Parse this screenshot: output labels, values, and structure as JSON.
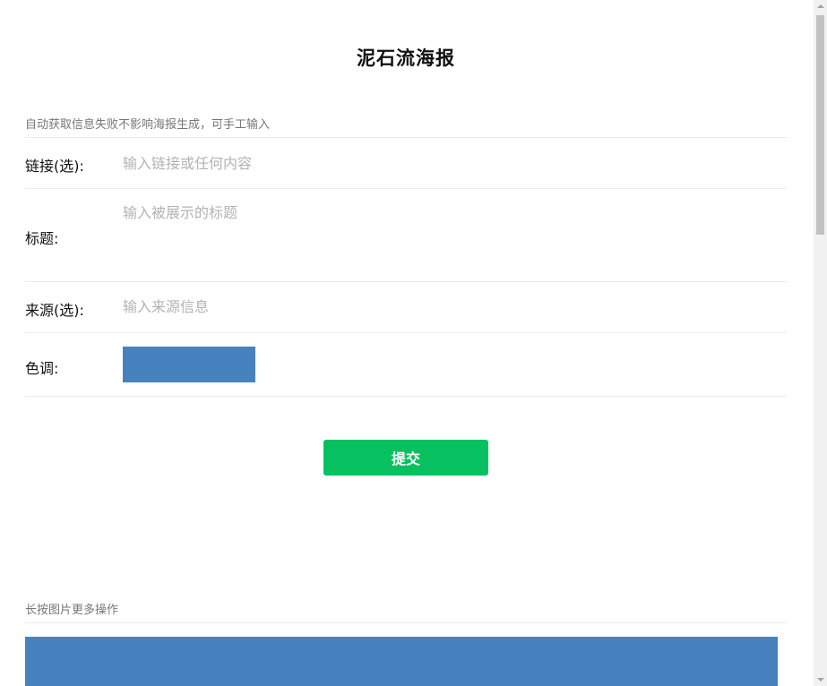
{
  "page": {
    "title": "泥石流海报"
  },
  "form": {
    "hint": "自动获取信息失败不影响海报生成，可手工输入",
    "link": {
      "label": "链接(选):",
      "placeholder": "输入链接或任何内容",
      "value": ""
    },
    "headline": {
      "label": "标题:",
      "placeholder": "输入被展示的标题",
      "value": ""
    },
    "source": {
      "label": "来源(选):",
      "placeholder": "输入来源信息",
      "value": ""
    },
    "tone": {
      "label": "色调:",
      "color": "#4682bd"
    },
    "submit_label": "提交"
  },
  "preview": {
    "hint": "长按图片更多操作",
    "color": "#4682bd"
  },
  "colors": {
    "accent_green": "#07c160",
    "divider": "#ececec",
    "hint_text": "#777777"
  }
}
